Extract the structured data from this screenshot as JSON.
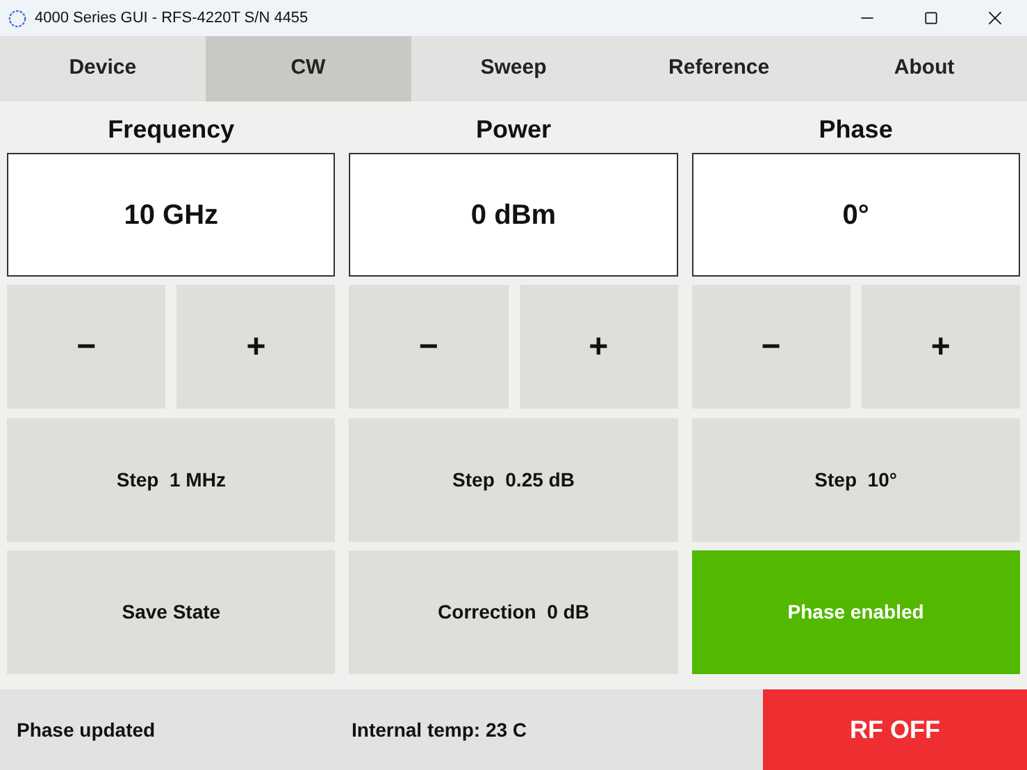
{
  "window": {
    "title": "4000 Series GUI - RFS-4220T S/N 4455"
  },
  "tabs": [
    {
      "label": "Device",
      "selected": false
    },
    {
      "label": "CW",
      "selected": true
    },
    {
      "label": "Sweep",
      "selected": false
    },
    {
      "label": "Reference",
      "selected": false
    },
    {
      "label": "About",
      "selected": false
    }
  ],
  "columns": [
    {
      "title": "Frequency",
      "value": "10 GHz",
      "decrement": "−",
      "increment": "+",
      "step": "Step  1 MHz",
      "action": {
        "label": "Save State",
        "active": false
      }
    },
    {
      "title": "Power",
      "value": "0 dBm",
      "decrement": "−",
      "increment": "+",
      "step": "Step  0.25 dB",
      "action": {
        "label": "Correction  0 dB",
        "active": false
      }
    },
    {
      "title": "Phase",
      "value": "0°",
      "decrement": "−",
      "increment": "+",
      "step": "Step  10°",
      "action": {
        "label": "Phase enabled",
        "active": true
      }
    }
  ],
  "status_bar": {
    "message": "Phase updated",
    "temperature": "Internal temp: 23 C",
    "rf_button": {
      "label": "RF OFF",
      "on": false
    }
  }
}
